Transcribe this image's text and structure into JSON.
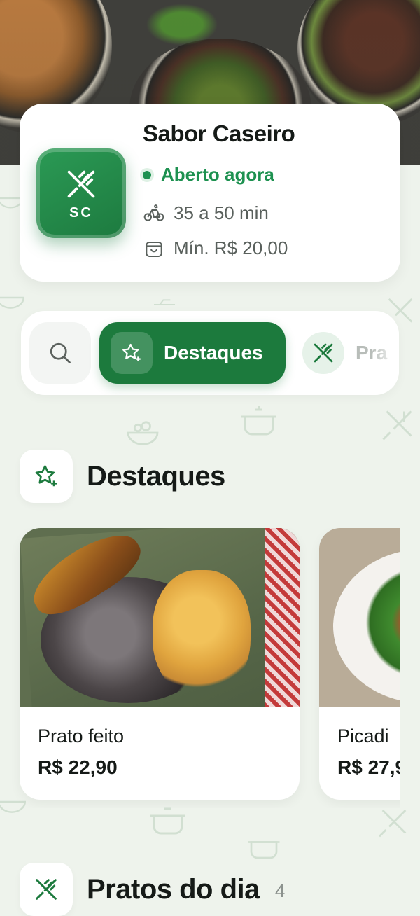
{
  "restaurant": {
    "name": "Sabor Caseiro",
    "initials": "SC",
    "status": "Aberto agora",
    "delivery_time": "35 a 50 min",
    "minimum_order": "Mín. R$ 20,00"
  },
  "tabs": [
    {
      "label": "Destaques",
      "icon": "star-sparkle-icon",
      "active": true
    },
    {
      "label": "Pra",
      "icon": "fork-knife-icon",
      "active": false
    }
  ],
  "sections": {
    "featured": {
      "title": "Destaques",
      "icon": "star-sparkle-icon"
    },
    "daily": {
      "title": "Pratos do dia",
      "count": "4",
      "icon": "fork-knife-icon"
    }
  },
  "products": [
    {
      "name": "Prato feito",
      "price": "R$ 22,90"
    },
    {
      "name": "Picadi",
      "price": "R$ 27,9"
    }
  ],
  "colors": {
    "brand_green": "#1c7a3d",
    "status_green": "#1d9150",
    "background": "#eef3ec"
  }
}
